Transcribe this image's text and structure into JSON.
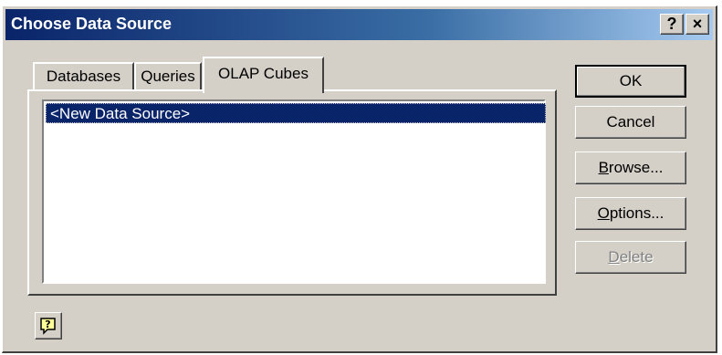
{
  "window": {
    "title": "Choose Data Source",
    "help_glyph": "?",
    "close_glyph": "×"
  },
  "tabs": [
    {
      "label": "Databases",
      "selected": false
    },
    {
      "label": "Queries",
      "selected": false
    },
    {
      "label": "OLAP Cubes",
      "selected": true
    }
  ],
  "list": {
    "items": [
      {
        "label": "<New Data Source>",
        "selected": true
      }
    ]
  },
  "buttons": {
    "ok": {
      "label": "OK",
      "default": true
    },
    "cancel": {
      "label": "Cancel"
    },
    "browse": {
      "mnemonic": "B",
      "rest": "rowse..."
    },
    "options": {
      "mnemonic": "O",
      "rest": "ptions..."
    },
    "delete": {
      "mnemonic": "D",
      "rest": "elete",
      "disabled": true
    }
  },
  "help_button": {
    "icon": "help-question-icon"
  },
  "colors": {
    "titlebar_start": "#0a246a",
    "titlebar_end": "#a6caf0",
    "face": "#d4d0c8",
    "selection": "#0a246a",
    "help_icon_fill": "#ffff99"
  }
}
